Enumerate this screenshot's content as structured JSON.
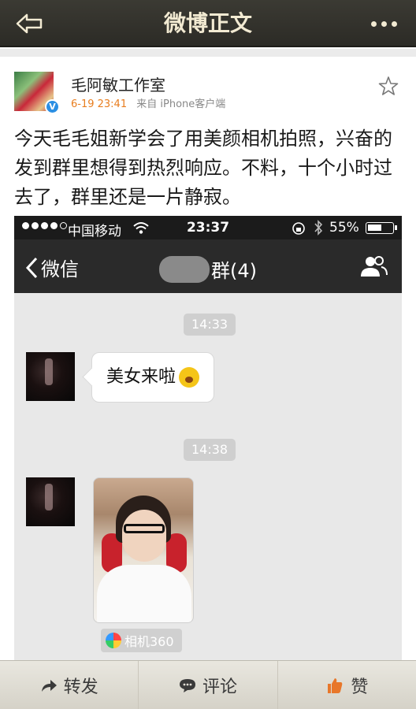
{
  "nav": {
    "title": "微博正文",
    "back_icon": "back-arrow-icon",
    "more_icon": "more-dots-icon"
  },
  "post": {
    "username": "毛阿敏工作室",
    "time": "6-19 23:41",
    "source": "来自 iPhone客户端",
    "text": "今天毛毛姐新学会了用美颜相机拍照，兴奋的发到群里想得到热烈响应。不料，十个小时过去了，群里还是一片静寂。"
  },
  "screenshot": {
    "status": {
      "carrier": "中国移动",
      "time": "23:37",
      "battery": "55%"
    },
    "chat": {
      "back_label": "微信",
      "group_title": "群(4)",
      "timestamp1": "14:33",
      "message1": "美女来啦",
      "timestamp2": "14:38",
      "app_tag": "相机360"
    }
  },
  "actions": {
    "repost": "转发",
    "comment": "评论",
    "like": "赞"
  },
  "colors": {
    "accent_time": "#e87d1e",
    "verified_badge": "#2b8fe3",
    "topbar": "#2c2b26"
  }
}
